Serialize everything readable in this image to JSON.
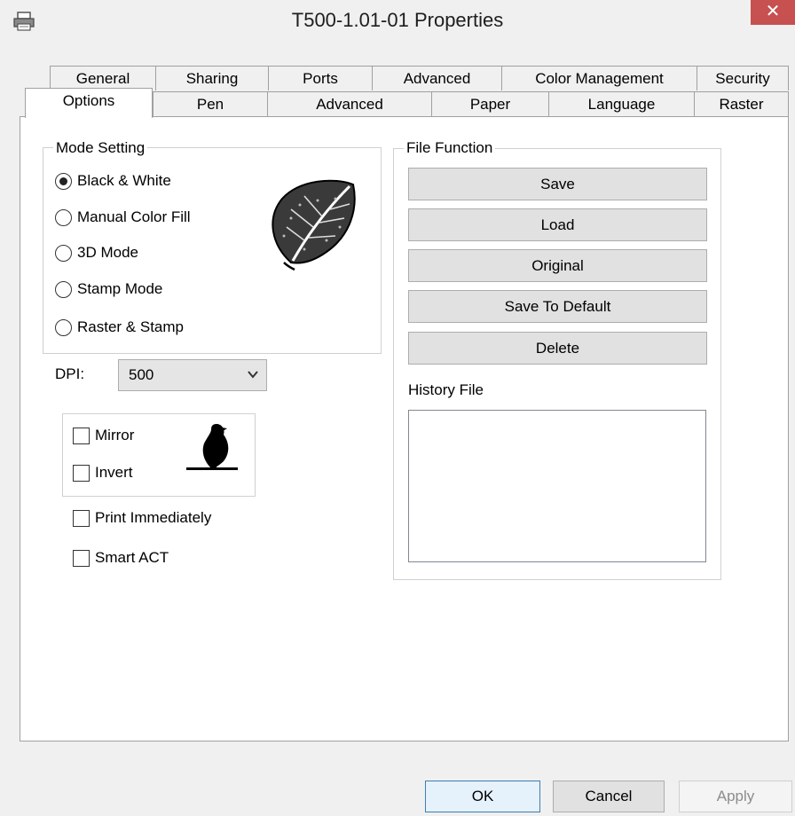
{
  "window": {
    "title": "T500-1.01-01 Properties",
    "close_label": "✕",
    "icon": "printer-icon"
  },
  "tabs_row1": [
    "General",
    "Sharing",
    "Ports",
    "Advanced",
    "Color Management",
    "Security"
  ],
  "tabs_row2": [
    "Options",
    "Pen",
    "Advanced",
    "Paper",
    "Language",
    "Raster"
  ],
  "active_tab": "Options",
  "mode_setting": {
    "label": "Mode Setting",
    "options": [
      "Black & White",
      "Manual Color Fill",
      "3D Mode",
      "Stamp Mode",
      "Raster & Stamp"
    ],
    "selected": "Black & White",
    "preview_icon": "leaf-icon"
  },
  "dpi": {
    "label": "DPI:",
    "value": "500"
  },
  "image_options": {
    "mirror": "Mirror",
    "invert": "Invert",
    "preview_icon": "bird-silhouette-icon"
  },
  "print_immediately": "Print Immediately",
  "smart_act": "Smart ACT",
  "file_function": {
    "label": "File Function",
    "buttons": [
      "Save",
      "Load",
      "Original",
      "Save To Default",
      "Delete"
    ],
    "history_label": "History File"
  },
  "footer": {
    "ok": "OK",
    "cancel": "Cancel",
    "apply": "Apply"
  },
  "colors": {
    "close_red": "#c75050",
    "ok_border": "#3c7fb1",
    "panel_bg": "#ffffff",
    "window_bg": "#f0f0f0"
  }
}
